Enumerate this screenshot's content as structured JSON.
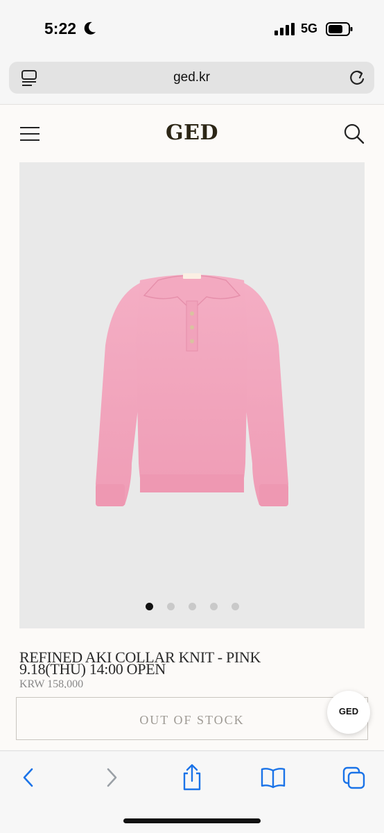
{
  "status_bar": {
    "time": "5:22",
    "network": "5G",
    "icons": [
      "moon-icon",
      "signal-bars-icon",
      "battery-icon"
    ]
  },
  "browser": {
    "url": "ged.kr",
    "icons": [
      "tabs-list-icon",
      "reload-icon"
    ]
  },
  "site_header": {
    "logo": "GED",
    "icons": [
      "hamburger-menu-icon",
      "search-icon"
    ]
  },
  "product": {
    "image_carousel": {
      "dot_count": 5,
      "active_index": 0
    },
    "name": "REFINED AKI COLLAR KNIT - PINK",
    "release": "9.18(THU) 14:00 OPEN",
    "price": "KRW 158,000",
    "stock_button": "OUT OF STOCK"
  },
  "floating_button": {
    "label": "GED"
  },
  "colors": {
    "page_bg": "#fcfaf8",
    "logo": "#2c2616",
    "sweater_pink": "#f2a6bd",
    "toolbar_accent": "#1a73e8"
  },
  "toolbar": {
    "icons": [
      "back-icon",
      "forward-icon",
      "share-icon",
      "bookmarks-icon",
      "tabs-icon"
    ]
  }
}
